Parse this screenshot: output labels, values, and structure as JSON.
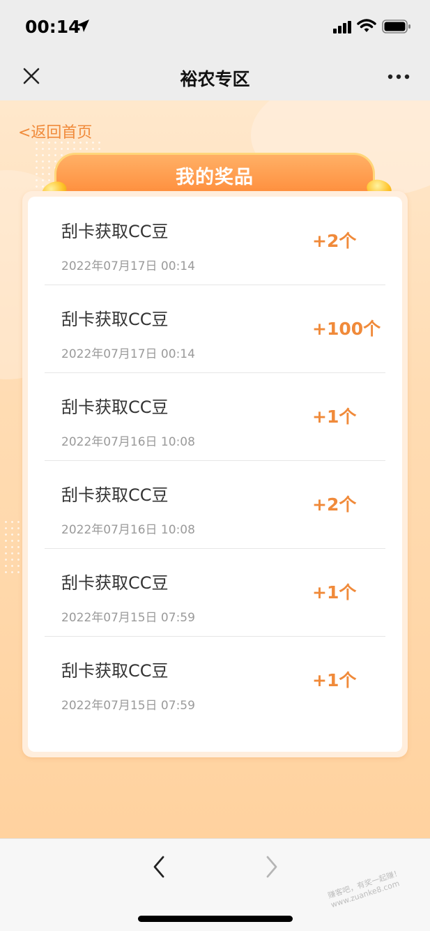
{
  "status_bar": {
    "time": "00:14"
  },
  "nav": {
    "title": "裕农专区"
  },
  "page": {
    "back_label": "<返回首页",
    "banner_title": "我的奖品"
  },
  "prizes": [
    {
      "title": "刮卡获取CC豆",
      "date": "2022年07月17日 00:14",
      "amount": "+2个"
    },
    {
      "title": "刮卡获取CC豆",
      "date": "2022年07月17日 00:14",
      "amount": "+100个"
    },
    {
      "title": "刮卡获取CC豆",
      "date": "2022年07月16日 10:08",
      "amount": "+1个"
    },
    {
      "title": "刮卡获取CC豆",
      "date": "2022年07月16日 10:08",
      "amount": "+2个"
    },
    {
      "title": "刮卡获取CC豆",
      "date": "2022年07月15日 07:59",
      "amount": "+1个"
    },
    {
      "title": "刮卡获取CC豆",
      "date": "2022年07月15日 07:59",
      "amount": "+1个"
    }
  ],
  "watermark": {
    "line1": "赚客吧，有奖一起赚！",
    "line2": "www.zuanke8.com"
  },
  "colors": {
    "accent": "#f08a3a",
    "banner": "#ff8c3a",
    "background": "#ffd9ab"
  },
  "icons": [
    "location-arrow-icon",
    "signal-icon",
    "wifi-icon",
    "battery-icon",
    "close-icon",
    "more-icon",
    "back-arrow-icon",
    "forward-arrow-icon"
  ]
}
